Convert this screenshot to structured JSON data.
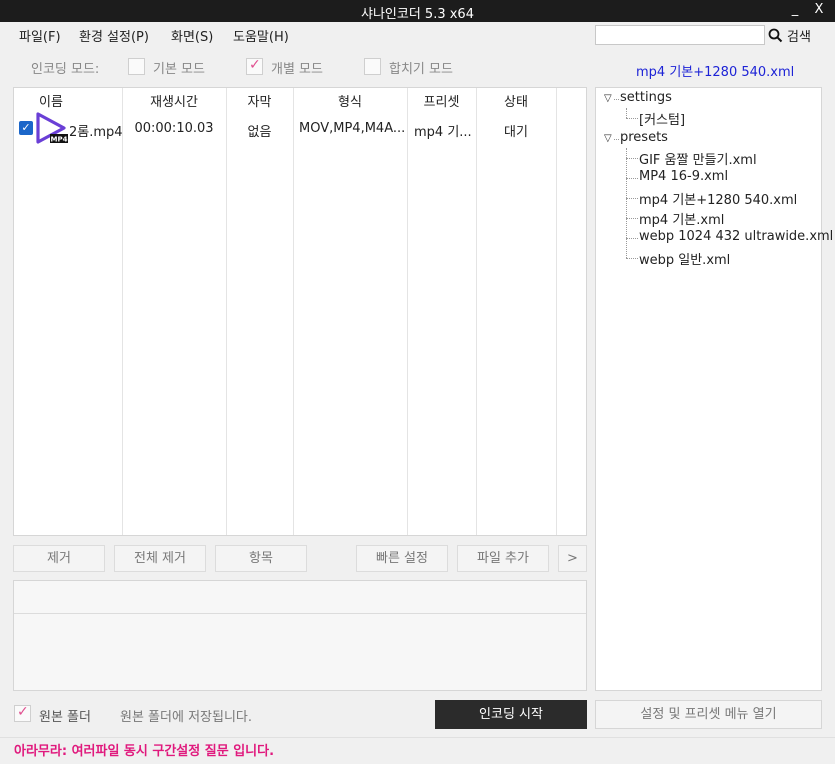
{
  "window": {
    "title": "샤나인코더  5.3 x64",
    "minimize_label": "_",
    "close_label": "X"
  },
  "menu": {
    "items": [
      "파일(F)",
      "환경 설정(P)",
      "화면(S)",
      "도움말(H)"
    ],
    "search_button_label": "검색",
    "search_value": ""
  },
  "mode": {
    "label": "인코딩 모드:",
    "options": [
      {
        "label": "기본 모드",
        "checked": false
      },
      {
        "label": "개별 모드",
        "checked": true
      },
      {
        "label": "합치기 모드",
        "checked": false
      }
    ]
  },
  "current_preset": "mp4 기본+1280 540.xml",
  "file_table": {
    "columns": [
      "이름",
      "재생시간",
      "자막",
      "형식",
      "프리셋",
      "상태"
    ],
    "rows": [
      {
        "checked": true,
        "icon_badge": "MP4",
        "name": "2롬.mp4",
        "duration": "00:00:10.03",
        "subtitle": "없음",
        "format": "MOV,MP4,M4A...",
        "preset": "mp4 기...",
        "status": "대기"
      }
    ]
  },
  "buttons": {
    "remove": "제거",
    "remove_all": "전체 제거",
    "items": "항목",
    "quick_settings": "빠른 설정",
    "add_file": "파일 추가",
    "more": ">",
    "encode_start": "인코딩 시작",
    "open_settings_menu": "설정 및 프리셋 메뉴 열기"
  },
  "tree": {
    "settings_label": "settings",
    "settings_children": [
      "[커스텀]"
    ],
    "presets_label": "presets",
    "presets_children": [
      "GIF 움짤 만들기.xml",
      "MP4 16-9.xml",
      "mp4 기본+1280 540.xml",
      "mp4 기본.xml",
      "webp 1024 432 ultrawide.xml",
      "webp 일반.xml"
    ]
  },
  "output": {
    "original_folder_checked": true,
    "original_folder_label": "원본 폴더",
    "original_folder_desc": "원본 폴더에 저장됩니다."
  },
  "status_message": "아라무라: 여러파일 동시 구간설정 질문 입니다.",
  "colors": {
    "accent_pink": "#e0197d",
    "link_blue": "#1d23d6",
    "play_icon_purple": "#6a3fd6",
    "checkbox_blue": "#1b66c9"
  }
}
